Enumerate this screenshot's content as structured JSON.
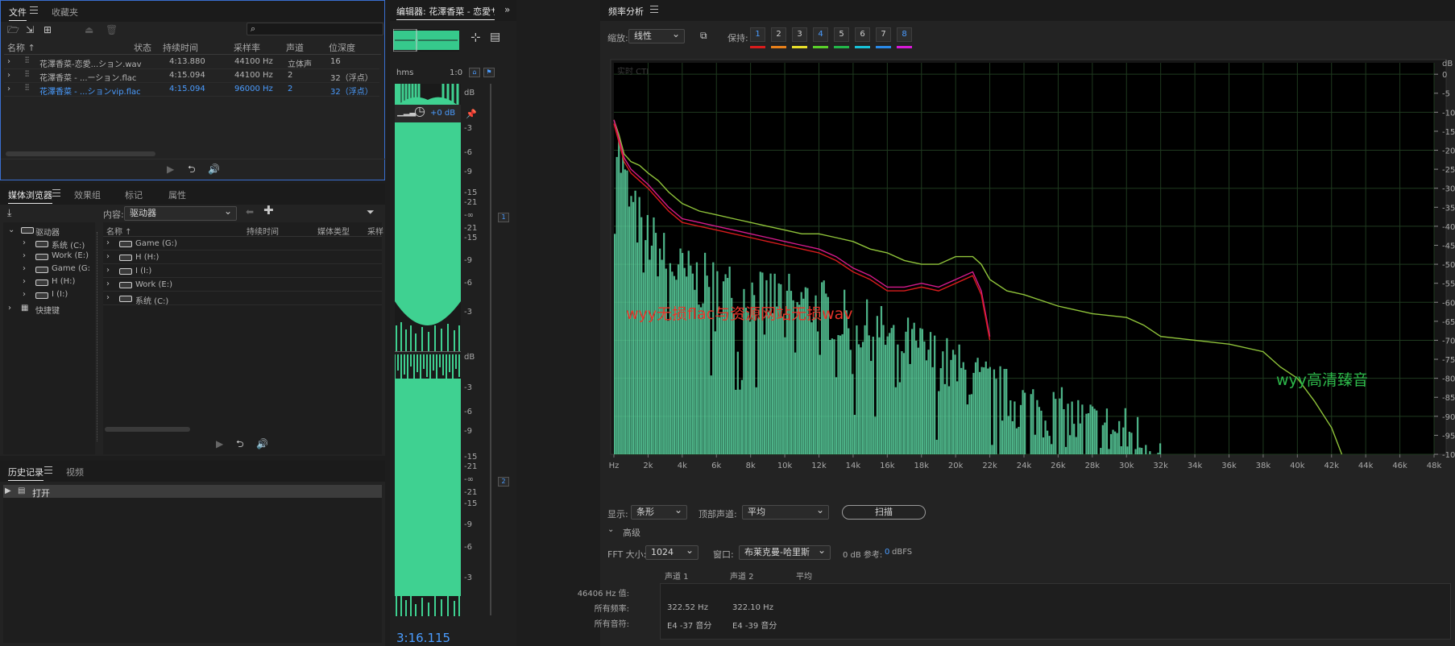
{
  "files_panel": {
    "tabs": [
      "文件",
      "收藏夹"
    ],
    "columns": [
      "名称",
      "状态",
      "持续时间",
      "采样率",
      "声道",
      "位深度"
    ],
    "rows": [
      {
        "name": "花澤香菜-恋愛...ション.wav",
        "duration": "4:13.880",
        "rate": "44100 Hz",
        "channels": "立体声",
        "depth": "16"
      },
      {
        "name": "花澤香菜 - ...ーション.flac",
        "duration": "4:15.094",
        "rate": "44100 Hz",
        "channels": "2",
        "depth": "32（浮点）"
      },
      {
        "name": "花澤香菜 - ...ションvip.flac",
        "duration": "4:15.094",
        "rate": "96000 Hz",
        "channels": "2",
        "depth": "32（浮点）"
      }
    ],
    "selected_row": 2
  },
  "media_panel": {
    "tabs": [
      "媒体浏览器",
      "效果组",
      "标记",
      "属性"
    ],
    "content_label": "内容:",
    "content_value": "驱动器",
    "tree_root": "驱动器",
    "tree_items": [
      "系统 (C:)",
      "Work (E:)",
      "Game (G:",
      "H (H:)",
      "I (I:)"
    ],
    "shortcuts": "快捷键",
    "columns": [
      "名称",
      "持续时间",
      "媒体类型",
      "采样"
    ],
    "list_items": [
      "Game (G:)",
      "H (H:)",
      "I (I:)",
      "Work (E:)",
      "系统 (C:)"
    ]
  },
  "history_panel": {
    "tabs": [
      "历史记录",
      "视频"
    ],
    "items": [
      "打开"
    ]
  },
  "editor_panel": {
    "title": "编辑器: 花澤香菜 - 恋愛サー",
    "ruler_unit": "hms",
    "ruler_mark": "1:0",
    "gain": "+0 dB",
    "db_label": "dB",
    "db_ticks_ch1": [
      "-3",
      "-6",
      "-9",
      "-15",
      "-21",
      "-∞",
      "-21",
      "-15",
      "-9",
      "-6",
      "-3"
    ],
    "db_ticks_ch2": [
      "-3",
      "-6",
      "-9",
      "-15",
      "-21",
      "-∞",
      "-21",
      "-15",
      "-9",
      "-6",
      "-3"
    ],
    "channel_1": "1",
    "channel_2": "2",
    "time": "3:16.115"
  },
  "freq_panel": {
    "title": "频率分析",
    "zoom_label": "缩放:",
    "zoom_value": "线性",
    "hold_label": "保持:",
    "holds": [
      "1",
      "2",
      "3",
      "4",
      "5",
      "6",
      "7",
      "8"
    ],
    "hold_colors": [
      "#d81c1c",
      "#e8801a",
      "#e8e02a",
      "#5ad12a",
      "#22b84a",
      "#18c2d8",
      "#2a8ae8",
      "#d81ad8"
    ],
    "watermark": "实时 CTI",
    "annotation_red": "wyy无损flac与资源网站无损wav",
    "annotation_green": "wyy高清臻音",
    "display_label": "显示:",
    "display_value": "条形",
    "top_channel_label": "顶部声道:",
    "top_channel_value": "平均",
    "scan_button": "扫描",
    "advanced": "高级",
    "fft_label": "FFT 大小:",
    "fft_value": "1024",
    "window_label": "窗口:",
    "window_value": "布莱克曼-哈里斯",
    "ref_label": "0 dB 参考:",
    "ref_value": "0",
    "ref_unit": "dBFS",
    "table_headers": [
      "声道 1",
      "声道 2",
      "平均"
    ],
    "table_rows": [
      {
        "label": "46406 Hz 值:",
        "c1": "",
        "c2": ""
      },
      {
        "label": "所有频率:",
        "c1": "322.52 Hz",
        "c2": "322.10 Hz"
      },
      {
        "label": "所有音符:",
        "c1": "E4 -37 音分",
        "c2": "E4 -39 音分"
      }
    ]
  },
  "chart_data": {
    "type": "line",
    "x_tick_labels": [
      "Hz",
      "2k",
      "4k",
      "6k",
      "8k",
      "10k",
      "12k",
      "14k",
      "16k",
      "18k",
      "20k",
      "22k",
      "24k",
      "26k",
      "28k",
      "30k",
      "32k",
      "34k",
      "36k",
      "38k",
      "40k",
      "42k",
      "44k",
      "46k",
      "48k"
    ],
    "y_tick_labels": [
      "dB",
      "0",
      "-5",
      "-10",
      "-15",
      "-20",
      "-25",
      "-30",
      "-35",
      "-40",
      "-45",
      "-50",
      "-55",
      "-60",
      "-65",
      "-70",
      "-75",
      "-80",
      "-85",
      "-90",
      "-95",
      "-100"
    ],
    "xlim": [
      0,
      48000
    ],
    "ylim": [
      -100,
      3
    ],
    "grid": true,
    "series": [
      {
        "name": "wyy高清臻音",
        "color": "#8fc33a",
        "x": [
          0,
          300,
          600,
          1000,
          1500,
          2000,
          2600,
          3200,
          4000,
          5000,
          6000,
          7000,
          8000,
          9000,
          10000,
          11000,
          12000,
          13000,
          14000,
          15000,
          16000,
          17000,
          18000,
          19000,
          20000,
          21000,
          21500,
          22000,
          23000,
          24000,
          26000,
          28000,
          30000,
          31000,
          32000,
          34000,
          36000,
          38000,
          39000,
          40000,
          41000,
          42000,
          42600
        ],
        "y": [
          -12,
          -16,
          -21,
          -23,
          -24,
          -26,
          -28,
          -31,
          -34,
          -36,
          -37,
          -38,
          -39,
          -40,
          -41,
          -42,
          -42,
          -43,
          -44,
          -46,
          -47,
          -49,
          -50,
          -50,
          -48,
          -48,
          -50,
          -54,
          -57,
          -58,
          -61,
          -63,
          -64,
          -66,
          -69,
          -70,
          -71,
          -73,
          -77,
          -80,
          -86,
          -93,
          -100
        ]
      },
      {
        "name": "",
        "color": "#d61a8c",
        "x": [
          0,
          300,
          600,
          1000,
          1500,
          2000,
          2600,
          3200,
          4000,
          5000,
          6000,
          7000,
          8000,
          9000,
          10000,
          11000,
          12000,
          13000,
          14000,
          15000,
          16000,
          17000,
          18000,
          19000,
          20000,
          21000,
          21500,
          22000
        ],
        "y": [
          -12,
          -17,
          -22,
          -25,
          -27,
          -29,
          -32,
          -35,
          -38,
          -39,
          -40,
          -41,
          -42,
          -43,
          -44,
          -45,
          -46,
          -48,
          -51,
          -53,
          -56,
          -56,
          -55,
          -56,
          -54,
          -52,
          -57,
          -69
        ]
      },
      {
        "name": "",
        "color": "#d81c1c",
        "x": [
          0,
          300,
          600,
          1000,
          1500,
          2000,
          2600,
          3200,
          4000,
          5000,
          6000,
          7000,
          8000,
          9000,
          10000,
          11000,
          12000,
          13000,
          14000,
          15000,
          16000,
          17000,
          18000,
          19000,
          20000,
          21000,
          21500,
          22000
        ],
        "y": [
          -13,
          -18,
          -23,
          -26,
          -28,
          -30,
          -33,
          -36,
          -39,
          -40,
          -41,
          -42,
          -43,
          -44,
          -45,
          -46,
          -47,
          -49,
          -52,
          -54,
          -57,
          -57,
          -56,
          -57,
          -55,
          -53,
          -58,
          -70
        ]
      }
    ],
    "bars_envelope": {
      "x": [
        0,
        500,
        1000,
        2000,
        3000,
        4000,
        6000,
        8000,
        10000,
        12000,
        14000,
        16000,
        18000,
        20000,
        22000,
        24000,
        26000,
        28000,
        30000,
        32000,
        34000,
        36000,
        38000,
        40000,
        42000,
        44000,
        46000,
        48000
      ],
      "y": [
        -15,
        -25,
        -35,
        -42,
        -48,
        -52,
        -55,
        -57,
        -58,
        -60,
        -65,
        -68,
        -72,
        -77,
        -82,
        -86,
        -89,
        -92,
        -94,
        -98,
        -99,
        -100,
        -100,
        -100,
        -100,
        -100,
        -100,
        -100
      ]
    }
  }
}
